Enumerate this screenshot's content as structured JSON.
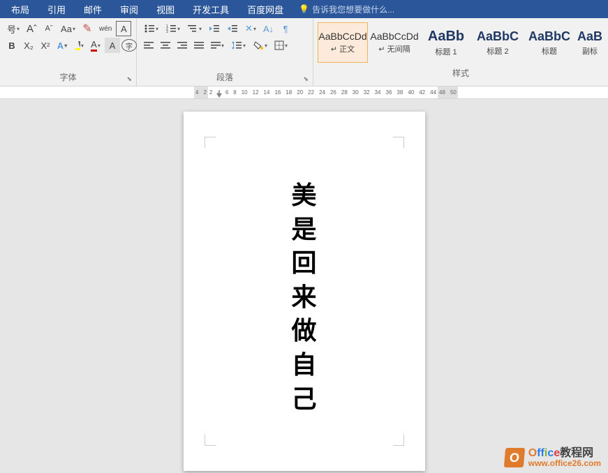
{
  "menu": {
    "items": [
      "布局",
      "引用",
      "邮件",
      "审阅",
      "视图",
      "开发工具",
      "百度网盘"
    ],
    "tellMe": "告诉我您想要做什么..."
  },
  "fontGroup": {
    "label": "字体",
    "growFont": "A",
    "shrinkFont": "A",
    "changeCase": "Aa",
    "phonetic": "wén",
    "charBorder": "A",
    "bold": "B",
    "clearFmt": "A",
    "circled": "字"
  },
  "paraGroup": {
    "label": "段落"
  },
  "styles": {
    "label": "样式",
    "items": [
      {
        "preview": "AaBbCcDd",
        "name": "↵ 正文",
        "big": false,
        "selected": true
      },
      {
        "preview": "AaBbCcDd",
        "name": "↵ 无间隔",
        "big": false,
        "selected": false
      },
      {
        "preview": "AaBb",
        "name": "标题 1",
        "big": true,
        "selected": false
      },
      {
        "preview": "AaBbC",
        "name": "标题 2",
        "big": true,
        "selected": false
      },
      {
        "preview": "AaBbC",
        "name": "标题",
        "big": true,
        "selected": false
      },
      {
        "preview": "AaB",
        "name": "副标",
        "big": true,
        "selected": false
      }
    ]
  },
  "ruler": {
    "grayTicks": [
      "4",
      "2"
    ],
    "whiteTicks": [
      "2",
      "4",
      "6",
      "8",
      "10",
      "12",
      "14",
      "16",
      "18",
      "20",
      "22",
      "24",
      "26",
      "28",
      "30",
      "32",
      "34",
      "36",
      "38",
      "40",
      "42",
      "44"
    ],
    "endGray": [
      "48",
      "50"
    ]
  },
  "document": {
    "chars": [
      "美",
      "是",
      "回",
      "来",
      "做",
      "自",
      "己"
    ]
  },
  "watermark": {
    "icon": "O",
    "title": "Office教程网",
    "url": "www.office26.com"
  }
}
